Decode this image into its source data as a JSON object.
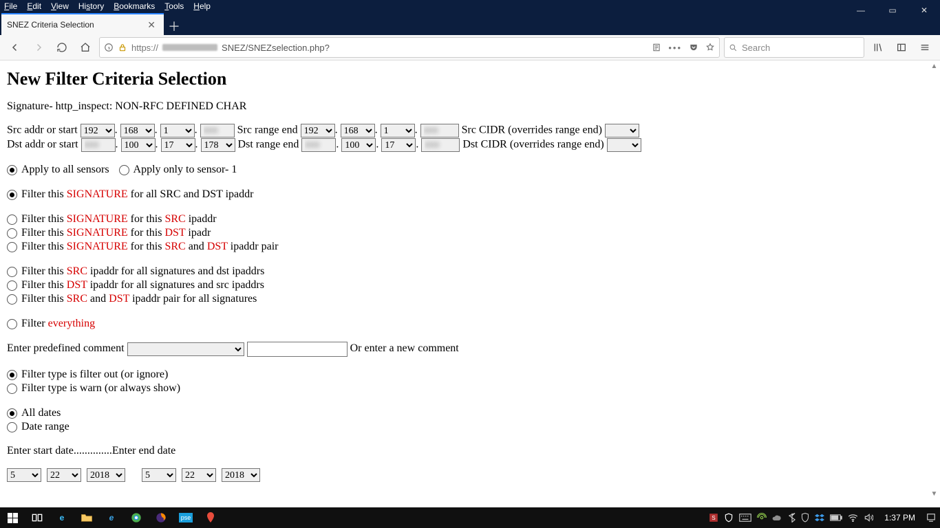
{
  "window": {
    "minimize": "—",
    "maximize": "▭",
    "close": "✕"
  },
  "menubar": [
    "File",
    "Edit",
    "View",
    "History",
    "Bookmarks",
    "Tools",
    "Help"
  ],
  "tab": {
    "title": "SNEZ Criteria Selection"
  },
  "url": {
    "protocol": "https://",
    "path_tail": "SNEZ/SNEZselection.php?"
  },
  "searchbar": {
    "placeholder": "Search"
  },
  "page": {
    "heading": "New Filter Criteria Selection",
    "signature_line": "Signature- http_inspect: NON-RFC DEFINED CHAR",
    "labels": {
      "src_start": "Src addr or start",
      "src_end": "Src range end",
      "src_cidr": "Src CIDR (overrides range end)",
      "dst_start": "Dst addr or start",
      "dst_end": "Dst range end",
      "dst_cidr": "Dst CIDR (overrides range end)",
      "predef_comment": "Enter predefined comment",
      "or_new_comment": "Or enter a new comment",
      "start_date": "Enter start date",
      "end_date": "Enter end date",
      "dots": ".............."
    },
    "src_start_octets": [
      "192",
      "168",
      "1",
      ""
    ],
    "src_end_octets": [
      "192",
      "168",
      "1",
      ""
    ],
    "dst_start_octets": [
      "",
      "100",
      "17",
      "178"
    ],
    "dst_end_octets": [
      "",
      "100",
      "17",
      ""
    ],
    "sensor_radios": {
      "all": "Apply to all sensors",
      "one": "Apply only to sensor- 1"
    },
    "filter_radios": {
      "sig_all": {
        "pre": "Filter this ",
        "k1": "SIGNATURE",
        "post": " for all SRC and DST ipaddr"
      },
      "sig_src": {
        "pre": "Filter this ",
        "k1": "SIGNATURE",
        "mid": " for this ",
        "k2": "SRC",
        "post": " ipaddr"
      },
      "sig_dst": {
        "pre": "Filter this ",
        "k1": "SIGNATURE",
        "mid": " for this ",
        "k2": "DST",
        "post": " ipadr"
      },
      "sig_pair": {
        "pre": "Filter this ",
        "k1": "SIGNATURE",
        "mid1": " for this ",
        "k2": "SRC",
        "mid2": " and ",
        "k3": "DST",
        "post": " ipaddr pair"
      },
      "src_all": {
        "pre": "Filter this ",
        "k1": "SRC",
        "post": " ipaddr for all signatures and dst ipaddrs"
      },
      "dst_all": {
        "pre": "Filter this ",
        "k1": "DST",
        "post": " ipaddr for all signatures and src ipaddrs"
      },
      "pair_all": {
        "pre": "Filter this ",
        "k1": "SRC",
        "mid": " and ",
        "k2": "DST",
        "post": " ipaddr pair for all signatures"
      },
      "everything": {
        "pre": "Filter ",
        "k1": "everything"
      }
    },
    "type_radios": {
      "out": "Filter type is filter out (or ignore)",
      "warn": "Filter type is warn (or always show)"
    },
    "date_radios": {
      "all": "All dates",
      "range": "Date range"
    },
    "start_date_values": [
      "5",
      "22",
      "2018"
    ],
    "end_date_values": [
      "5",
      "22",
      "2018"
    ]
  },
  "taskbar": {
    "clock": "1:37 PM"
  },
  "colors": {
    "chrome": "#0c1e3e",
    "accent_red": "#d60000",
    "tab_highlight": "#2a84ff"
  }
}
